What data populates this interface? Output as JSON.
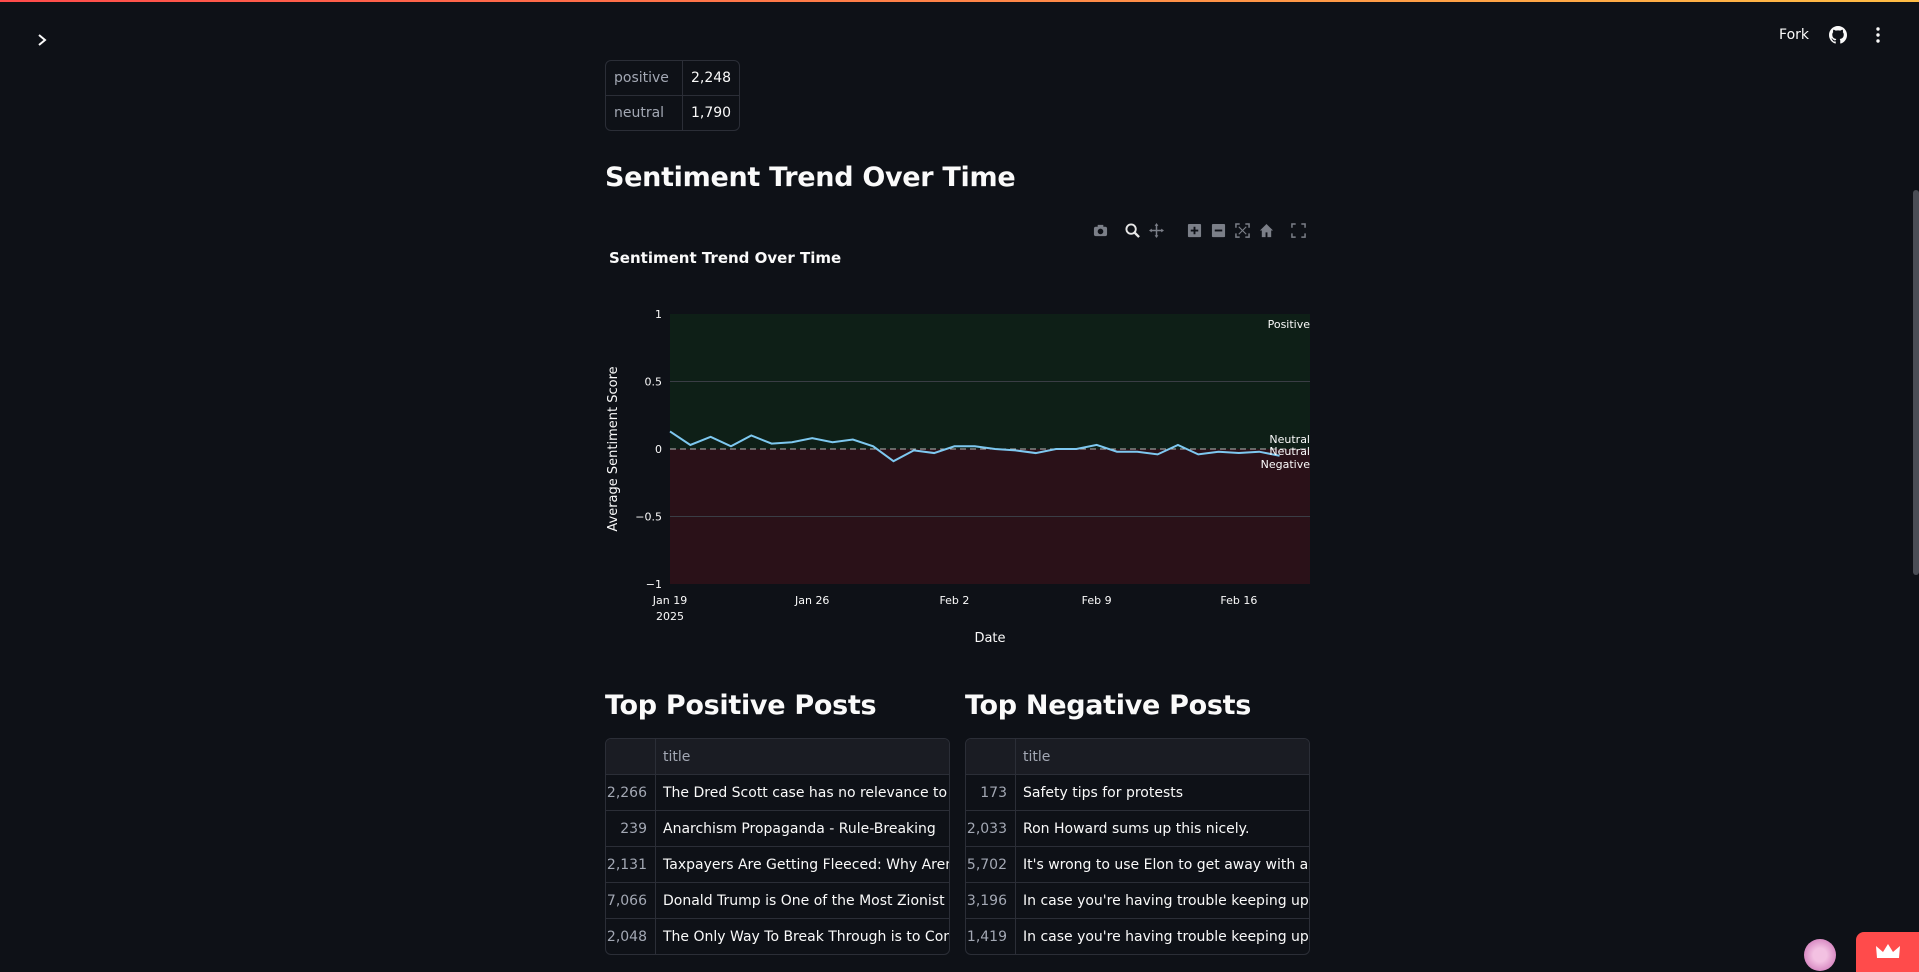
{
  "header": {
    "fork_label": "Fork"
  },
  "stats": [
    {
      "key": "positive",
      "value": "2,248"
    },
    {
      "key": "neutral",
      "value": "1,790"
    }
  ],
  "trend_section_title": "Sentiment Trend Over Time",
  "chart_data": {
    "type": "line",
    "title": "Sentiment Trend Over Time",
    "xlabel": "Date",
    "ylabel": "Average Sentiment Score",
    "ylim": [
      -1,
      1
    ],
    "yticks": [
      "1",
      "0.5",
      "0",
      "−0.5",
      "−1"
    ],
    "xticks": [
      "Jan 19",
      "Jan 26",
      "Feb 2",
      "Feb 9",
      "Feb 16"
    ],
    "xtick_year": "2025",
    "x": [
      "2025-01-19",
      "2025-01-20",
      "2025-01-21",
      "2025-01-22",
      "2025-01-23",
      "2025-01-24",
      "2025-01-25",
      "2025-01-26",
      "2025-01-27",
      "2025-01-28",
      "2025-01-29",
      "2025-01-30",
      "2025-01-31",
      "2025-02-01",
      "2025-02-02",
      "2025-02-03",
      "2025-02-04",
      "2025-02-05",
      "2025-02-06",
      "2025-02-07",
      "2025-02-08",
      "2025-02-09",
      "2025-02-10",
      "2025-02-11",
      "2025-02-12",
      "2025-02-13",
      "2025-02-14",
      "2025-02-15",
      "2025-02-16",
      "2025-02-17",
      "2025-02-18"
    ],
    "values": [
      0.13,
      0.03,
      0.09,
      0.02,
      0.1,
      0.04,
      0.05,
      0.08,
      0.05,
      0.07,
      0.02,
      -0.09,
      -0.01,
      -0.03,
      0.02,
      0.02,
      0.0,
      -0.01,
      -0.03,
      0.0,
      0.0,
      0.03,
      -0.02,
      -0.02,
      -0.04,
      0.03,
      -0.04,
      -0.02,
      -0.03,
      -0.02,
      -0.05
    ],
    "annotations": [
      "Positive",
      "Neutral",
      "Neutral",
      "Negative"
    ],
    "line_color": "#7ec8f0",
    "positive_band_color": "#0e1f17",
    "negative_band_color": "#2a1118",
    "grid": true
  },
  "top_positive": {
    "title": "Top Positive Posts",
    "column": "title",
    "rows": [
      {
        "index": "2,266",
        "title": "The Dred Scott case has no relevance to the secor"
      },
      {
        "index": "239",
        "title": "Anarchism Propaganda - Rule-Breaking"
      },
      {
        "index": "2,131",
        "title": "Taxpayers Are Getting Fleeced: Why Aren't Our Ta"
      },
      {
        "index": "7,066",
        "title": "Donald Trump is One of the Most Zionist Presider"
      },
      {
        "index": "2,048",
        "title": "The Only Way To Break Through is to Connect Wh"
      }
    ]
  },
  "top_negative": {
    "title": "Top Negative Posts",
    "column": "title",
    "rows": [
      {
        "index": "173",
        "title": "Safety tips for protests"
      },
      {
        "index": "2,033",
        "title": "Ron Howard sums up this nicely."
      },
      {
        "index": "5,702",
        "title": "It's wrong to use Elon to get away with anti-Afrika"
      },
      {
        "index": "3,196",
        "title": "In case you're having trouble keeping up, here's a"
      },
      {
        "index": "1,419",
        "title": "In case you're having trouble keeping up, here's a"
      }
    ]
  }
}
